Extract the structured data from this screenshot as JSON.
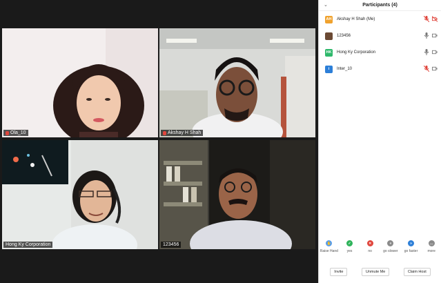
{
  "gallery": {
    "tiles": [
      {
        "name": "Ola_10",
        "muted": true,
        "active": false
      },
      {
        "name": "Akshay H Shah",
        "muted": true,
        "active": false
      },
      {
        "name": "Hong Ky Corporation",
        "muted": false,
        "active": true
      },
      {
        "name": "123456",
        "muted": false,
        "active": false
      }
    ]
  },
  "participants": {
    "title": "Participants (4)",
    "collapse_icon": "chevron-down",
    "rows": [
      {
        "initials": "AH",
        "name": "Akshay H Shah (Me)",
        "avatar_color": "#f0a22e",
        "audio": "muted",
        "video": "off"
      },
      {
        "initials": "",
        "name": "123456",
        "avatar_color": "#6b4a34",
        "audio": "on",
        "video": "on"
      },
      {
        "initials": "HK",
        "name": "Hong Ky Corporation",
        "avatar_color": "#2eb86b",
        "audio": "on",
        "video": "on"
      },
      {
        "initials": "i",
        "name": "Inter_10",
        "avatar_color": "#2d7fd8",
        "audio": "muted",
        "video": "on"
      }
    ]
  },
  "reactions": [
    {
      "label": "Raise Hand",
      "color": "#5a9ee8",
      "glyph": "✋"
    },
    {
      "label": "yes",
      "color": "#2fb35b",
      "glyph": "✓"
    },
    {
      "label": "no",
      "color": "#e0453c",
      "glyph": "✕"
    },
    {
      "label": "go slower",
      "color": "#8a8a8a",
      "glyph": "«"
    },
    {
      "label": "go faster",
      "color": "#2d7fd8",
      "glyph": "»"
    },
    {
      "label": "more",
      "color": "#8a8a8a",
      "glyph": "…"
    }
  ],
  "footer": {
    "invite_label": "Invite",
    "unmute_label": "Unmute Me",
    "claim_host_label": "Claim Host"
  },
  "colors": {
    "active_speaker": "#d6e07a",
    "muted_red": "#e0453c"
  }
}
